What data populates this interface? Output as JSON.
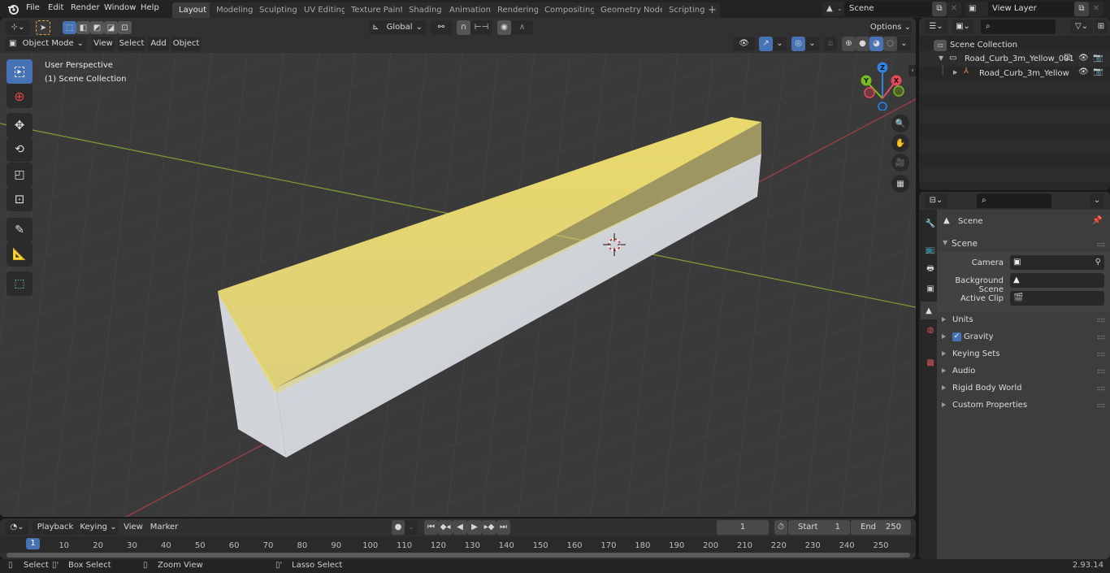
{
  "app": {
    "name": "Blender",
    "version": "2.93.14"
  },
  "menu": [
    "File",
    "Edit",
    "Render",
    "Window",
    "Help"
  ],
  "workspaces": [
    {
      "label": "Layout",
      "active": true
    },
    {
      "label": "Modeling"
    },
    {
      "label": "Sculpting"
    },
    {
      "label": "UV Editing"
    },
    {
      "label": "Texture Paint"
    },
    {
      "label": "Shading"
    },
    {
      "label": "Animation"
    },
    {
      "label": "Rendering"
    },
    {
      "label": "Compositing"
    },
    {
      "label": "Geometry Nodes"
    },
    {
      "label": "Scripting"
    }
  ],
  "add_workspace": "+",
  "scene_selector": {
    "value": "Scene",
    "icon": "scene-icon"
  },
  "view_layer_selector": {
    "value": "View Layer",
    "icon": "view-layer-icon"
  },
  "viewport": {
    "mode": "Object Mode",
    "menus": [
      "View",
      "Select",
      "Add",
      "Object"
    ],
    "transform_orientation": "Global",
    "options_label": "Options",
    "overlay_text": [
      "User Perspective",
      "(1) Scene Collection"
    ],
    "tools": [
      "select-box",
      "cursor",
      "move",
      "rotate",
      "scale",
      "transform",
      "annotate",
      "measure",
      "add-cube"
    ],
    "gizmo": {
      "x": "X",
      "y": "Y",
      "z": "Z",
      "x_color": "#e8485a",
      "y_color": "#7ab91f",
      "z_color": "#2f84e0"
    },
    "nav_buttons": [
      "zoom-icon",
      "hand-pan-icon",
      "camera-icon",
      "perspective-grid-icon"
    ],
    "object_colors": {
      "top": "#e7d767",
      "side": "#cfd3d8",
      "grid_bg": "#3a3a3a"
    }
  },
  "outliner": {
    "root": "Scene Collection",
    "items": [
      {
        "label": "Road_Curb_3m_Yellow_001",
        "type": "collection",
        "checked": true
      },
      {
        "label": "Road_Curb_3m_Yellow",
        "type": "object"
      }
    ]
  },
  "properties": {
    "context_label": "Scene",
    "panel_title": "Scene",
    "fields": [
      {
        "label": "Camera",
        "value": ""
      },
      {
        "label": "Background Scene",
        "value": ""
      },
      {
        "label": "Active Clip",
        "value": ""
      }
    ],
    "subpanels": [
      {
        "label": "Units"
      },
      {
        "label": "Gravity",
        "checkbox": true
      },
      {
        "label": "Keying Sets"
      },
      {
        "label": "Audio"
      },
      {
        "label": "Rigid Body World"
      },
      {
        "label": "Custom Properties"
      }
    ]
  },
  "timeline": {
    "menus": [
      "Playback",
      "Keying",
      "View",
      "Marker"
    ],
    "current_frame": "1",
    "start_label": "Start",
    "start": "1",
    "end_label": "End",
    "end": "250",
    "playhead": "1",
    "ticks": [
      "10",
      "20",
      "30",
      "40",
      "50",
      "60",
      "70",
      "80",
      "90",
      "100",
      "110",
      "120",
      "130",
      "140",
      "150",
      "160",
      "170",
      "180",
      "190",
      "200",
      "210",
      "220",
      "230",
      "240",
      "250"
    ]
  },
  "statusbar": {
    "hints": [
      {
        "label": "Select",
        "icon": "mouse-left-icon"
      },
      {
        "label": "Box Select",
        "icon": "mouse-drag-icon"
      },
      {
        "label": "Zoom View",
        "icon": "mouse-middle-icon"
      },
      {
        "label": "Lasso Select",
        "icon": "mouse-right-drag-icon"
      }
    ],
    "version": "2.93.14"
  }
}
